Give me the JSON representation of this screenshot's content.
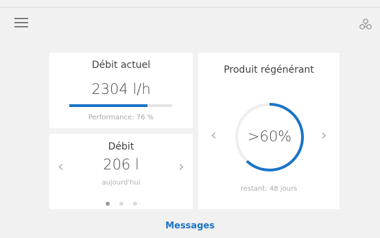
{
  "colors": {
    "accent": "#1a73c8",
    "background": "#f1f1f1",
    "card": "#ffffff"
  },
  "header": {
    "menu_icon": "hamburger-menu-icon",
    "settings_icon": "settings-icon"
  },
  "flow_card": {
    "title": "Débit actuel",
    "value": "2304 l/h",
    "performance_label": "Performance: 76 %",
    "performance_fraction": 0.76
  },
  "daily_card": {
    "title": "Débit",
    "value": "206 l",
    "subtitle": "aujourd'hui",
    "prev_icon": "chevron-left-icon",
    "next_icon": "chevron-right-icon",
    "pages": 3,
    "active_page": 1
  },
  "regen_card": {
    "title": "Produit régénérant",
    "value": ">60%",
    "gauge_fraction": 0.62,
    "remaining": "restant: 48 jours",
    "prev_icon": "chevron-left-icon",
    "next_icon": "chevron-right-icon"
  },
  "footer": {
    "messages_label": "Messages"
  }
}
